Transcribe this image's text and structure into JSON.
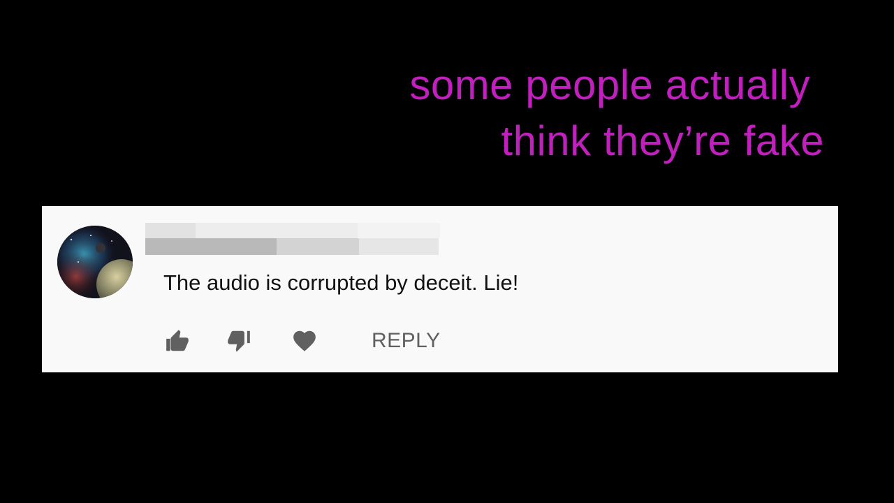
{
  "caption": {
    "line1": "some people actually",
    "line2": "think they’re fake",
    "color": "#c21fbf"
  },
  "comment": {
    "avatar_icon": "planet-avatar",
    "username_redacted": true,
    "text": "The audio is corrupted by deceit. Lie!",
    "actions": {
      "like_icon": "thumbs-up-icon",
      "dislike_icon": "thumbs-down-icon",
      "heart_icon": "heart-icon",
      "reply_label": "REPLY"
    }
  },
  "colors": {
    "background": "#000000",
    "card": "#f9f9f9",
    "text": "#111111",
    "muted": "#606060"
  }
}
